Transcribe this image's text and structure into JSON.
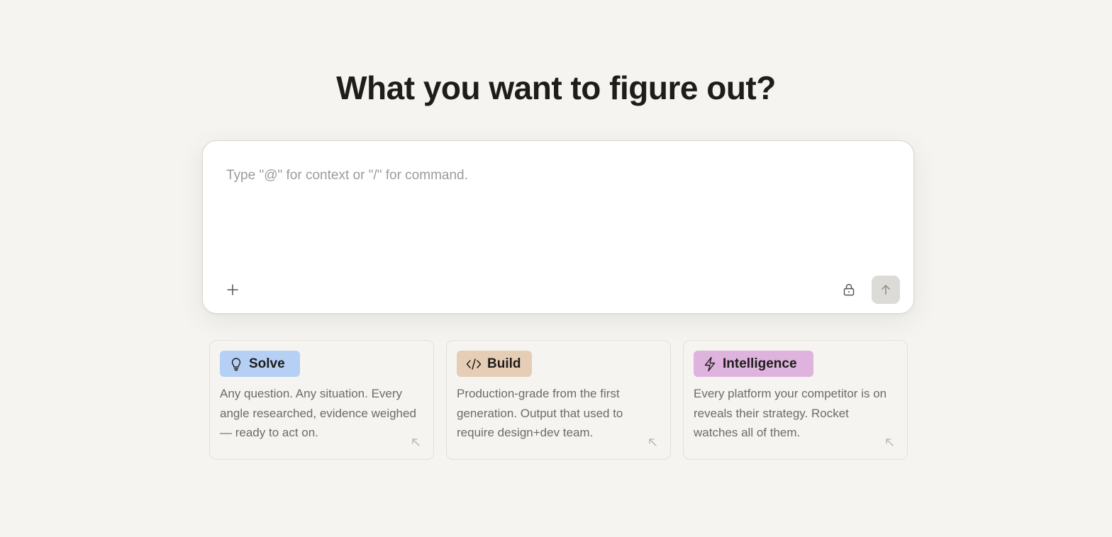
{
  "headline": "What you want to figure out?",
  "composer": {
    "placeholder": "Type \"@\" for context or \"/\" for command.",
    "value": "",
    "add_icon": "plus-icon",
    "lock_icon": "lock-icon",
    "send_icon": "arrow-up-icon"
  },
  "cards": [
    {
      "label": "Solve",
      "icon": "lightbulb-icon",
      "color": "#b6cff5",
      "description": "Any question. Any situation. Every angle researched, evidence weighed — ready to act on.",
      "corner_icon": "arrow-up-left-icon"
    },
    {
      "label": "Build",
      "icon": "code-icon",
      "color": "#e6cdb5",
      "description": "Production-grade from the first generation. Output that used to require design+dev team.",
      "corner_icon": "arrow-up-left-icon"
    },
    {
      "label": "Intelligence",
      "icon": "lightning-icon",
      "color": "#deb3de",
      "description": "Every platform your competitor is on reveals their strategy. Rocket watches all of them.",
      "corner_icon": "arrow-up-left-icon"
    }
  ],
  "colors": {
    "background": "#f5f4f0",
    "send_button": "#dcdbd7",
    "text_primary": "#1f1d1a",
    "text_secondary": "#6d6b66"
  }
}
